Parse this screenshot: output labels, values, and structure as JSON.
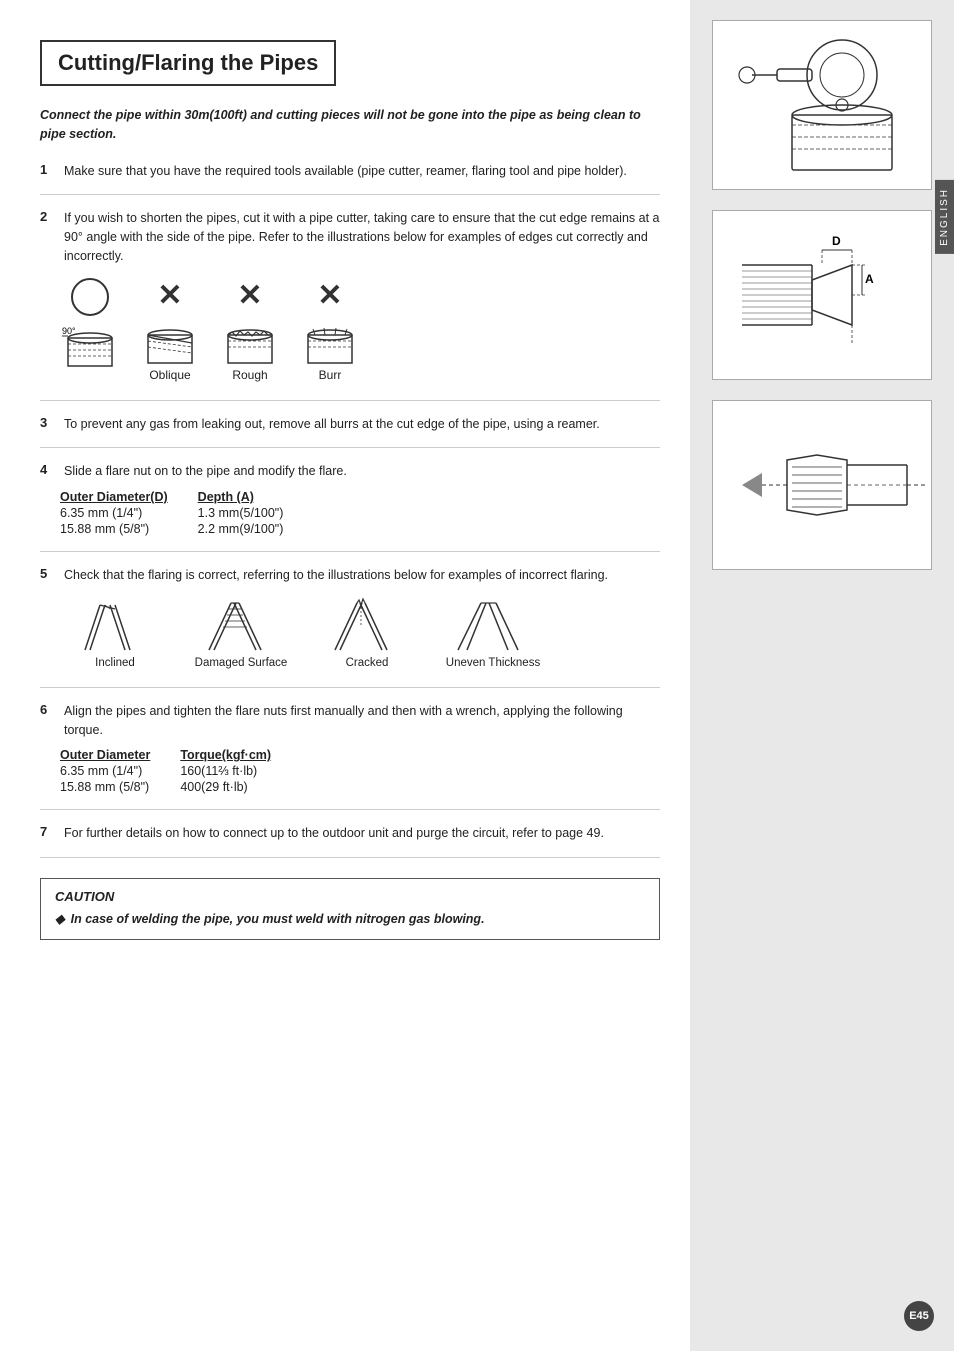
{
  "page": {
    "title": "Cutting/Flaring the Pipes",
    "page_number": "E45",
    "english_label": "ENGLISH"
  },
  "intro": {
    "text": "Connect the pipe within 30m(100ft) and cutting pieces will not be gone into the pipe as being clean to pipe section."
  },
  "steps": [
    {
      "number": "1",
      "text": "Make sure that you have the required tools available (pipe cutter, reamer, flaring tool and pipe holder)."
    },
    {
      "number": "2",
      "text": "If you wish to shorten the pipes, cut it with a pipe cutter, taking care to ensure that the cut edge remains at a 90° angle with the side of the pipe. Refer to the illustrations below for examples of edges cut correctly and incorrectly."
    },
    {
      "number": "3",
      "text": "To prevent any gas from leaking out, remove all burrs at the cut edge of the pipe, using a reamer."
    },
    {
      "number": "4",
      "text": "Slide a flare nut on to the pipe and modify the flare."
    },
    {
      "number": "5",
      "text": "Check that the flaring is correct, referring to the illustrations below for examples of incorrect flaring."
    },
    {
      "number": "6",
      "text": "Align the pipes and tighten the flare nuts first manually and then with a wrench, applying the following torque."
    },
    {
      "number": "7",
      "text": "For further details on how to connect up to the outdoor unit and purge the circuit, refer to page 49."
    }
  ],
  "cut_labels": {
    "correct_angle": "90°",
    "oblique": "Oblique",
    "rough": "Rough",
    "burr": "Burr"
  },
  "flaring_table": {
    "col1_header": "Outer Diameter(D)",
    "col2_header": "Depth (A)",
    "rows": [
      {
        "col1": "6.35 mm (1/4\")",
        "col2": "1.3 mm(5/100\")"
      },
      {
        "col1": "15.88 mm (5/8\")",
        "col2": "2.2 mm(9/100\")"
      }
    ]
  },
  "flare_labels": {
    "inclined": "Inclined",
    "damaged": "Damaged Surface",
    "cracked": "Cracked",
    "uneven": "Uneven Thickness"
  },
  "torque_table": {
    "col1_header": "Outer Diameter",
    "col2_header": "Torque(kgf·cm)",
    "rows": [
      {
        "col1": "6.35 mm (1/4\")",
        "col2": "160(11⅔ ft·lb)"
      },
      {
        "col1": "15.88 mm (5/8\")",
        "col2": "400(29 ft·lb)"
      }
    ]
  },
  "caution": {
    "title": "CAUTION",
    "text": "In case of welding the pipe, you must weld with nitrogen gas blowing."
  }
}
